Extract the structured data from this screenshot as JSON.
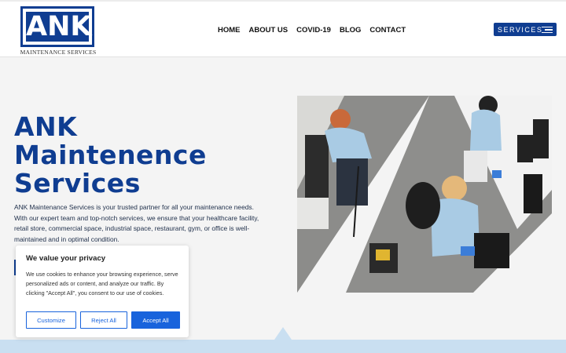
{
  "header": {
    "logo_text": "ANK",
    "logo_subtitle": "MAINTENANCE SERVICES",
    "nav": [
      {
        "label": "HOME"
      },
      {
        "label": "ABOUT US"
      },
      {
        "label": "COVID-19"
      },
      {
        "label": "BLOG"
      },
      {
        "label": "CONTACT"
      }
    ],
    "services_label": "SERVICES"
  },
  "hero": {
    "title_lines": [
      "ANK",
      "Maintenence",
      "Services"
    ],
    "description": "ANK Maintenance Services is your trusted partner for all your maintenance needs. With our expert team and top-notch services, we ensure that your healthcare facility, retail store, commercial space, industrial space, restaurant, gym, or office is well-maintained and in optimal condition."
  },
  "cookie": {
    "title": "We value your privacy",
    "text": "We use cookies to enhance your browsing experience, serve personalized ads or content, and analyze our traffic. By clicking \"Accept All\", you consent to our use of cookies.",
    "customize_label": "Customize",
    "reject_label": "Reject All",
    "accept_label": "Accept All"
  },
  "colors": {
    "brand": "#0f3d91",
    "cookie_accent": "#1863dc",
    "band": "#c9dff1"
  }
}
